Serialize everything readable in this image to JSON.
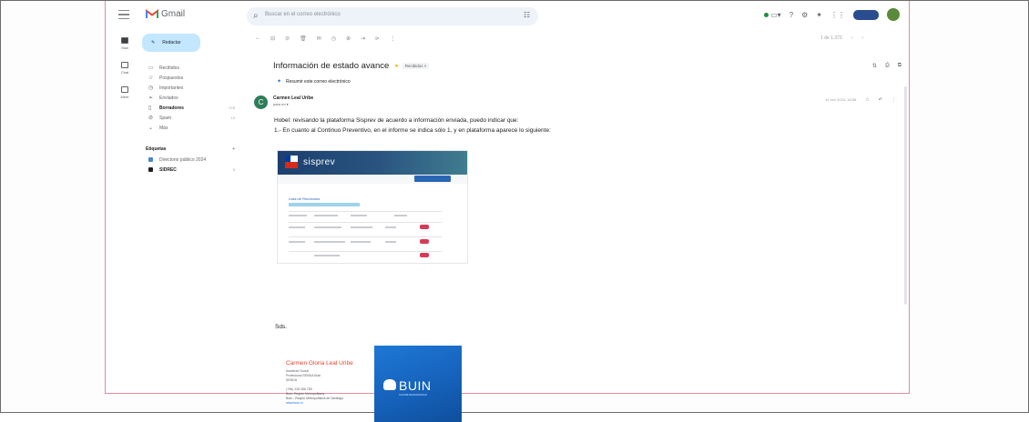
{
  "app": {
    "name": "Gmail"
  },
  "search": {
    "placeholder": "Buscar en el correo electrónico"
  },
  "rail": [
    {
      "label": "Mail",
      "active": true
    },
    {
      "label": "Chat",
      "active": false
    },
    {
      "label": "Meet",
      "active": false
    }
  ],
  "compose_label": "Redactar",
  "nav": [
    {
      "icon": "inbox-icon",
      "glyph": "▭",
      "label": "Recibidos",
      "count": "",
      "bold": false
    },
    {
      "icon": "star-icon",
      "glyph": "☆",
      "label": "Pospuestos",
      "count": "",
      "bold": false
    },
    {
      "icon": "snooze-icon",
      "glyph": "◷",
      "label": "Importantes",
      "count": "",
      "bold": false
    },
    {
      "icon": "send-icon",
      "glyph": "➢",
      "label": "Enviados",
      "count": "",
      "bold": false
    },
    {
      "icon": "draft-icon",
      "glyph": "▯",
      "label": "Borradores",
      "count": "278",
      "bold": true
    },
    {
      "icon": "spam-icon",
      "glyph": "⊘",
      "label": "Spam",
      "count": "13",
      "bold": false
    },
    {
      "icon": "more-icon",
      "glyph": "⌄",
      "label": "Más",
      "count": "",
      "bold": false
    }
  ],
  "labels": {
    "title": "Etiquetas",
    "items": [
      {
        "label": "Directorio público 2024",
        "color": "#4a86c8",
        "count": ""
      },
      {
        "label": "SIDREC",
        "color": "#202124",
        "count": "5",
        "bold": true
      }
    ]
  },
  "email": {
    "subject": "Información de estado avance",
    "label_chip": "Recibidos ×",
    "summarize": "Resumir este correo electrónico",
    "sender_initial": "C",
    "sender_name": "Carmen Leal Uribe",
    "sender_to": "para mí ▾",
    "date": "14 nov 2024, 16:58",
    "greeting": "Hobel: revisando la plataforma Sisprev de acuerdo a información enviada, puedo indicar que:",
    "line1": "1.-  En cuanto al Continuo Preventivo, en el informe se indica sólo 1, y en plataforma aparece lo siguiente:",
    "closing": "Sds.",
    "embedded": {
      "app_title": "sisprev",
      "section": "Lista de Reuniones"
    },
    "signature": {
      "name": "Carmen Gloria Leal Uribe",
      "lines": [
        "Asistente Social",
        "Profesional SENDA Buin",
        "SENDA",
        "",
        "(+56) 228 456 789",
        "Buin, Región Metropolitana",
        "Buin - Región Metropolitana de Santiago",
        "www.buin.cl"
      ],
      "logo_text": "BUIN",
      "logo_tagline": "ILUSTRE MUNICIPALIDAD"
    }
  },
  "pager": "1 de 1.373",
  "brand_colors": {
    "compose": "#c2e7ff",
    "signature_name": "#e0452e",
    "logo_blue": "#1560b8"
  }
}
